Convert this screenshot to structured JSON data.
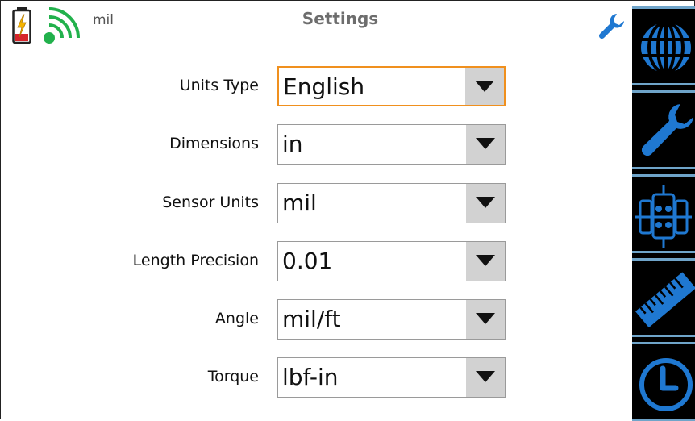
{
  "header": {
    "title": "Settings",
    "status_text": "mil",
    "battery_icon": "battery-charging-icon",
    "signal_icon": "wireless-signal-icon",
    "tool_icon": "wrench-icon"
  },
  "settings": [
    {
      "label": "Units Type",
      "value": "English",
      "focused": true
    },
    {
      "label": "Dimensions",
      "value": "in",
      "focused": false
    },
    {
      "label": "Sensor Units",
      "value": "mil",
      "focused": false
    },
    {
      "label": "Length Precision",
      "value": "0.01",
      "focused": false
    },
    {
      "label": "Angle",
      "value": "mil/ft",
      "focused": false
    },
    {
      "label": "Torque",
      "value": "lbf-in",
      "focused": false
    }
  ],
  "nav": {
    "items": [
      "globe-icon",
      "wrench-icon",
      "machine-alignment-icon",
      "ruler-icon",
      "clock-icon"
    ]
  },
  "colors": {
    "accent_blue": "#1f78d1",
    "focus_orange": "#f0901e",
    "rail_border": "#6fa4c9",
    "signal_green": "#22b14c",
    "battery_red": "#d6242b"
  }
}
